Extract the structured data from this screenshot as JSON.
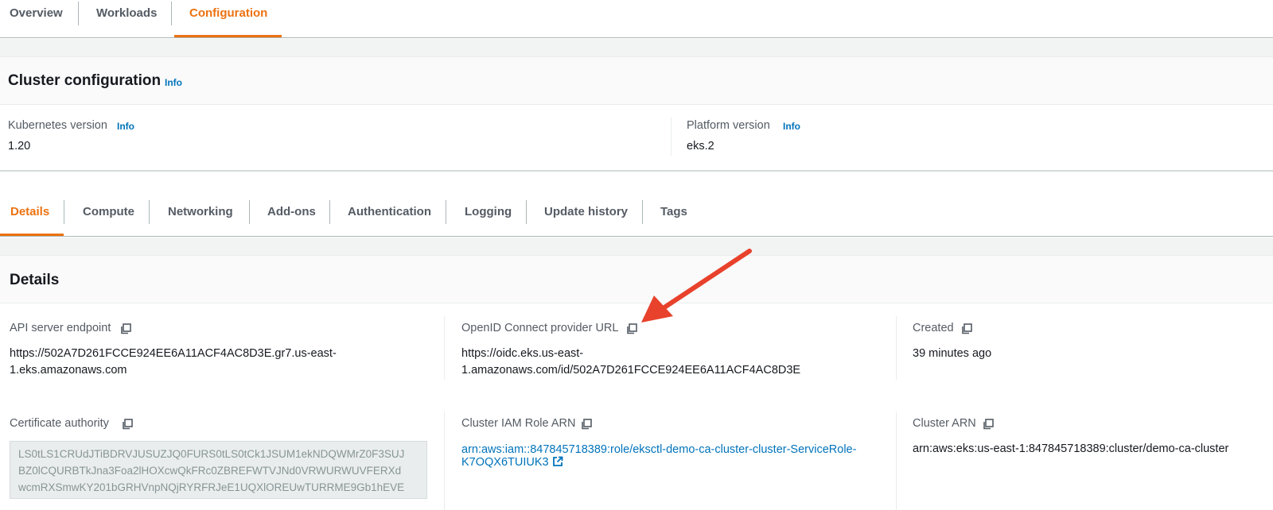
{
  "top_tabs": {
    "items": [
      {
        "label": "Overview"
      },
      {
        "label": "Workloads"
      },
      {
        "label": "Configuration",
        "active": true
      }
    ]
  },
  "cluster_config": {
    "title": "Cluster configuration",
    "info": "Info",
    "kubernetes_version": {
      "label": "Kubernetes version",
      "info": "Info",
      "value": "1.20"
    },
    "platform_version": {
      "label": "Platform version",
      "info": "Info",
      "value": "eks.2"
    }
  },
  "sub_tabs": {
    "items": [
      {
        "label": "Details",
        "active": true
      },
      {
        "label": "Compute"
      },
      {
        "label": "Networking"
      },
      {
        "label": "Add-ons"
      },
      {
        "label": "Authentication"
      },
      {
        "label": "Logging"
      },
      {
        "label": "Update history"
      },
      {
        "label": "Tags"
      }
    ]
  },
  "details": {
    "title": "Details",
    "api_server_endpoint": {
      "label": "API server endpoint",
      "value_line1": "https://502A7D261FCCE924EE6A11ACF4AC8D3E.gr7.us-east-",
      "value_line2": "1.eks.amazonaws.com"
    },
    "openid_connect": {
      "label": "OpenID Connect provider URL",
      "value_line1": "https://oidc.eks.us-east-",
      "value_line2": "1.amazonaws.com/id/502A7D261FCCE924EE6A11ACF4AC8D3E"
    },
    "created": {
      "label": "Created",
      "value": "39 minutes ago"
    },
    "certificate_authority": {
      "label": "Certificate authority",
      "line1": "LS0tLS1CRUdJTiBDRVJUSUZJQ0FURS0tLS0tCk1JSUM1ekNDQWMrZ0F3SUJ",
      "line2": "BZ0lCQURBTkJna3Foa2lHOXcwQkFRc0ZBREFWTVJNd0VRWURWUVFERXd",
      "line3": "wcmRXSmwKY201bGRHVnpNQjRYRFRJeE1UQXlOREUwTURRME9Gb1hEVE"
    },
    "cluster_iam_role_arn": {
      "label": "Cluster IAM Role ARN",
      "value_line1": "arn:aws:iam::847845718389:role/eksctl-demo-ca-cluster-cluster-ServiceRole-",
      "value_line2": "K7OQX6TUIUK3"
    },
    "cluster_arn": {
      "label": "Cluster ARN",
      "value": "arn:aws:eks:us-east-1:847845718389:cluster/demo-ca-cluster"
    }
  },
  "icons": {
    "copy": "copy-icon",
    "external_link": "external-link-icon",
    "annotation": "red-arrow-annotation"
  },
  "colors": {
    "accent": "#ec7211",
    "link": "#0073bb",
    "annotation": "#e8412c"
  }
}
